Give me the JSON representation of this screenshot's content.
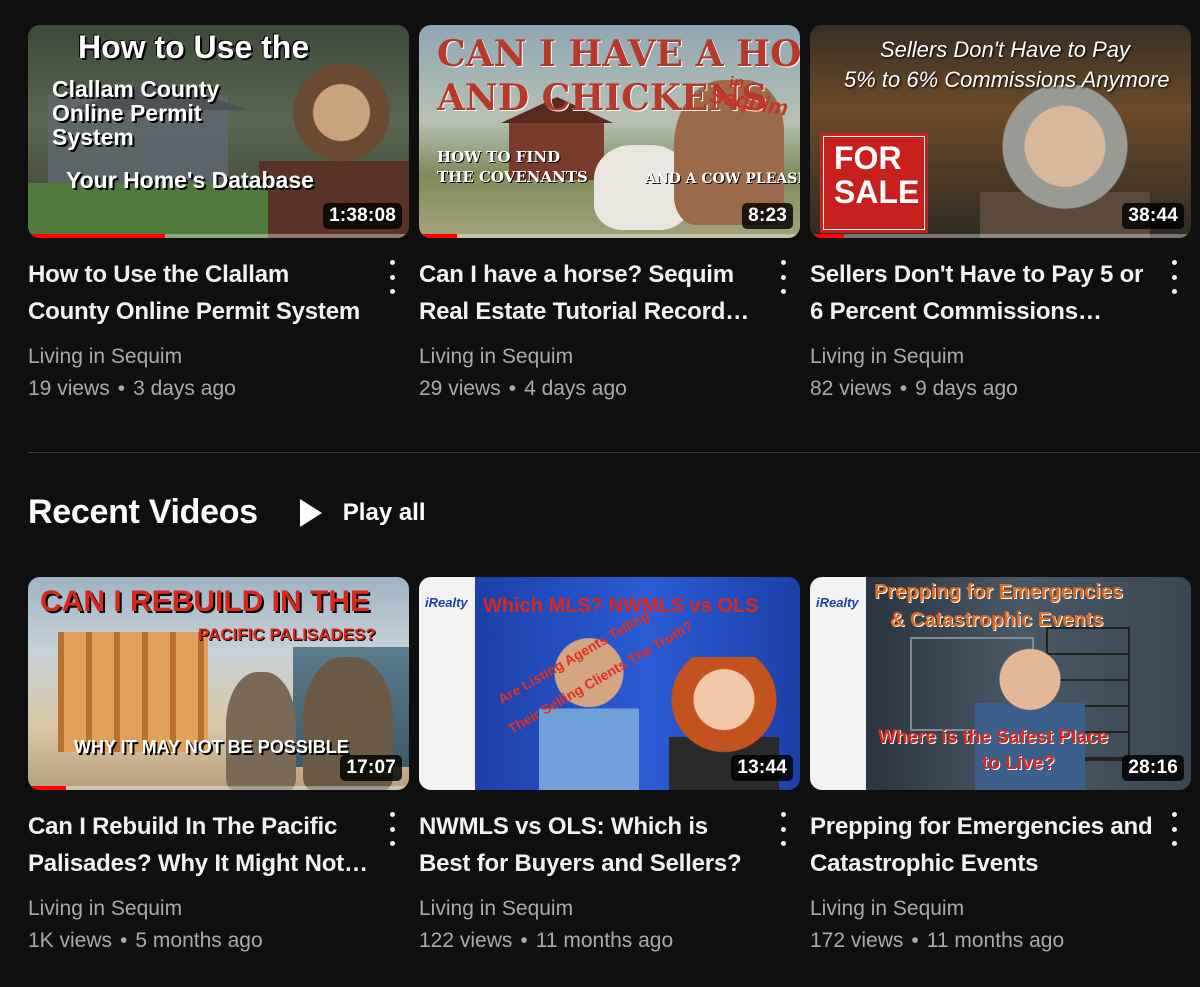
{
  "top_videos": [
    {
      "title": "How to Use the Clallam County Online Permit System",
      "channel": "Living in Sequim",
      "views": "19 views",
      "age": "3 days ago",
      "duration": "1:38:08",
      "progress": 0.36,
      "thumb_text": [
        "How to Use the",
        "Clallam County",
        "Online Permit",
        "System",
        "Your Home's Database"
      ]
    },
    {
      "title": "Can I have a horse? Sequim Real Estate Tutorial Record…",
      "channel": "Living in Sequim",
      "views": "29 views",
      "age": "4 days ago",
      "duration": "8:23",
      "progress": 0.1,
      "thumb_text": [
        "CAN I HAVE A HORSE",
        "AND CHICKENS",
        "in",
        "Sequim",
        "HOW TO FIND",
        "THE COVENANTS",
        "AND A COW PLEASE?"
      ]
    },
    {
      "title": "Sellers Don't Have to Pay 5 or 6 Percent Commissions…",
      "channel": "Living in Sequim",
      "views": "82 views",
      "age": "9 days ago",
      "duration": "38:44",
      "progress": 0.09,
      "thumb_text": [
        "Sellers Don't Have to Pay",
        "5% to 6% Commissions Anymore",
        "FOR",
        "SALE"
      ]
    }
  ],
  "section": {
    "title": "Recent Videos",
    "play_all": "Play all"
  },
  "recent_videos": [
    {
      "title": "Can I Rebuild In The Pacific Palisades? Why It Might Not…",
      "channel": "Living in Sequim",
      "views": "1K views",
      "age": "5 months ago",
      "duration": "17:07",
      "progress": 0.1,
      "thumb_text": [
        "CAN I REBUILD IN THE",
        "PACIFIC PALISADES?",
        "WHY IT MAY NOT BE POSSIBLE"
      ]
    },
    {
      "title": "NWMLS vs OLS: Which is Best for Buyers and Sellers?",
      "channel": "Living in Sequim",
      "views": "122 views",
      "age": "11 months ago",
      "duration": "13:44",
      "progress": 0,
      "thumb_text": [
        "Which MLS? NWMLS vs OLS",
        "Are Listing Agents Telling",
        "Their Selling Clients The Truth?",
        "iRealty"
      ]
    },
    {
      "title": "Prepping for Emergencies and Catastrophic Events",
      "channel": "Living in Sequim",
      "views": "172 views",
      "age": "11 months ago",
      "duration": "28:16",
      "progress": 0,
      "thumb_text": [
        "Prepping for Emergencies",
        "& Catastrophic Events",
        "Where is the Safest Place",
        "to Live?",
        "iRealty"
      ]
    }
  ],
  "colors": {
    "background": "#0f0f0f",
    "progress": "#ff0000",
    "secondary_text": "#aaaaaa"
  },
  "icons": [
    "more-vert-icon",
    "play-icon"
  ]
}
